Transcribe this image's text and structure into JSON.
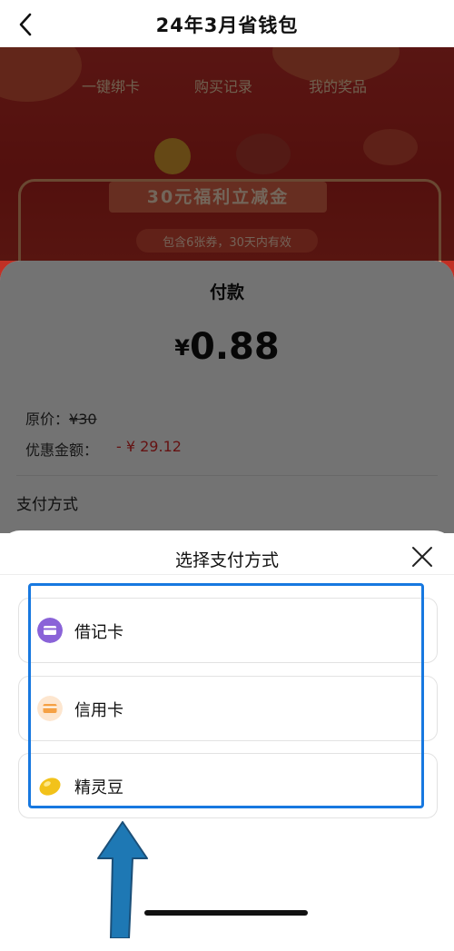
{
  "nav": {
    "title": "24年3月省钱包",
    "back_icon": "chevron-left-icon"
  },
  "promo": {
    "tabs": [
      "一键绑卡",
      "购买记录",
      "我的奖品"
    ],
    "title": "30元福利立减金",
    "subtitle": "包含6张券，30天内有效"
  },
  "payment": {
    "title": "付款",
    "currency": "¥",
    "amount": "0.88",
    "original_label": "原价：",
    "original_value": "¥30",
    "discount_label": "优惠金额：",
    "discount_value": "- ¥ 29.12",
    "method_label": "支付方式"
  },
  "select_sheet": {
    "title": "选择支付方式",
    "close_icon": "close-icon",
    "options": [
      {
        "label": "借记卡",
        "icon": "debit-card-icon",
        "color": "#8a63d8"
      },
      {
        "label": "信用卡",
        "icon": "credit-card-icon",
        "color": "#f5a145"
      },
      {
        "label": "精灵豆",
        "icon": "bean-icon",
        "color": "#f2c21a"
      }
    ]
  },
  "colors": {
    "highlight": "#1778e0",
    "arrow": "#1e78b4",
    "discount": "#e02a2a"
  }
}
